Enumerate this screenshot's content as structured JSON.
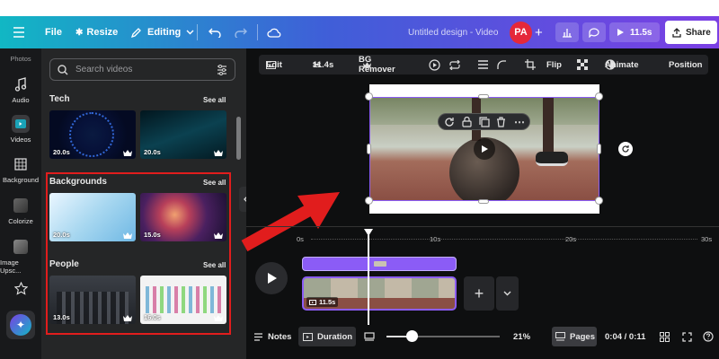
{
  "header": {
    "file_label": "File",
    "resize_label": "Resize",
    "editing_label": "Editing",
    "title": "Untitled design - Video",
    "avatar_initials": "PA",
    "duration_label": "11.5s",
    "share_label": "Share"
  },
  "rail": {
    "photos_label": "Photos",
    "audio_label": "Audio",
    "videos_label": "Videos",
    "background_label": "Background",
    "colorize_label": "Colorize",
    "image_upscale_label": "Image Upsc..."
  },
  "panel": {
    "search_placeholder": "Search videos",
    "sections": [
      {
        "title": "Tech",
        "see_all": "See all",
        "items": [
          {
            "duration": "20.0s"
          },
          {
            "duration": "20.0s"
          }
        ]
      },
      {
        "title": "Backgrounds",
        "see_all": "See all",
        "items": [
          {
            "duration": "20.0s"
          },
          {
            "duration": "15.0s"
          }
        ]
      },
      {
        "title": "People",
        "see_all": "See all",
        "items": [
          {
            "duration": "13.0s"
          },
          {
            "duration": "16.0s"
          }
        ]
      }
    ]
  },
  "context_toolbar": {
    "edit_label": "Edit",
    "trim_label": "11.4s",
    "bg_remover_label": "BG Remover",
    "flip_label": "Flip",
    "animate_label": "Animate",
    "position_label": "Position"
  },
  "timeline": {
    "ticks": [
      "0s",
      "10s",
      "20s",
      "30s"
    ],
    "clip_duration": "11.5s"
  },
  "footer": {
    "notes_label": "Notes",
    "duration_label": "Duration",
    "zoom_value": "21%",
    "pages_label": "Pages",
    "time_display": "0:04 / 0:11"
  },
  "colors": {
    "accent_purple": "#8b5cf6",
    "highlight_red": "#e11d1d",
    "avatar_red": "#e5283a"
  }
}
